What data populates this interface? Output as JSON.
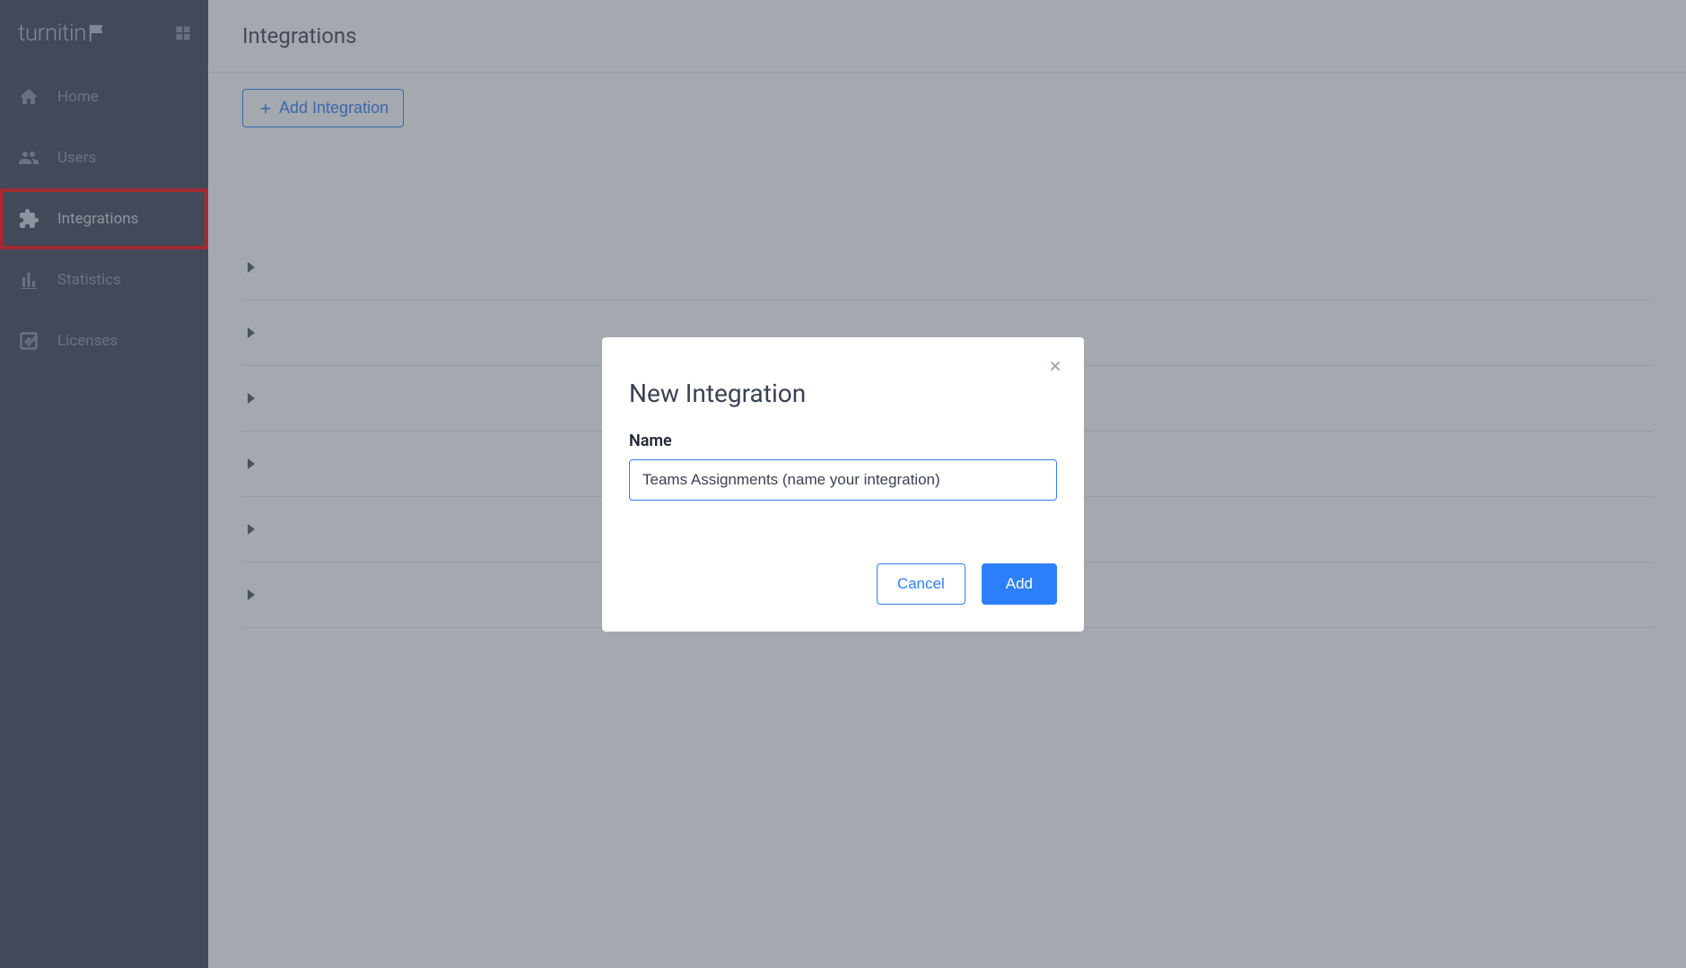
{
  "brand": {
    "name": "turnitin"
  },
  "sidebar": {
    "items": [
      {
        "label": "Home"
      },
      {
        "label": "Users"
      },
      {
        "label": "Integrations"
      },
      {
        "label": "Statistics"
      },
      {
        "label": "Licenses"
      }
    ]
  },
  "page": {
    "title": "Integrations",
    "add_button_label": "Add Integration"
  },
  "modal": {
    "title": "New Integration",
    "name_label": "Name",
    "name_value": "Teams Assignments (name your integration)",
    "cancel_label": "Cancel",
    "add_label": "Add"
  }
}
